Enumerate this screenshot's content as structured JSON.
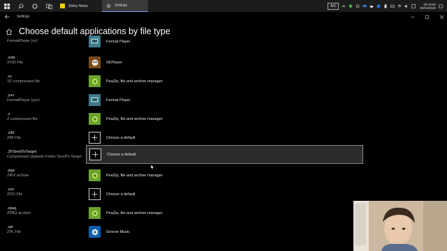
{
  "taskbar": {
    "apps": [
      {
        "label": "Sticky Notes",
        "icon": "sticky-notes-icon",
        "color": "#f5d000"
      },
      {
        "label": "Settings",
        "icon": "gear-icon",
        "color": "#cccccc",
        "active": true
      }
    ],
    "keyboard_indicator": "A/C",
    "clock_time": "09:18:50",
    "clock_date": "09/03/2020"
  },
  "window": {
    "title": "Settings"
  },
  "page": {
    "title": "Choose default applications by file type"
  },
  "rows": [
    {
      "ext": "",
      "desc": "FormatPlayer (xv)",
      "app": "Format Player",
      "icon": "format-player-icon"
    },
    {
      "ext": ".xvid",
      "desc": "XVID File",
      "app": "SKPlayer",
      "icon": "skplayer-icon"
    },
    {
      "ext": ".xz",
      "desc": "XZ compressed file",
      "app": "PeaZip, file and archive manager",
      "icon": "peazip-icon"
    },
    {
      "ext": ".yuv",
      "desc": "FormatPlayer (yuv)",
      "app": "Format Player",
      "icon": "format-player-icon"
    },
    {
      "ext": ".z",
      "desc": "Z compressed file",
      "app": "PeaZip, file and archive manager",
      "icon": "peazip-icon"
    },
    {
      "ext": ".z96",
      "desc": "Z96 File",
      "app": "Choose a default",
      "icon": "plus-icon"
    },
    {
      "ext": ".ZFSendToTarget",
      "desc": "Compressed (zipped) Folder SendTo Target",
      "app": "Choose a default",
      "icon": "plus-icon",
      "hover": true
    },
    {
      "ext": ".zipx",
      "desc": "ZIPX archive",
      "app": "PeaZip, file and archive manager",
      "icon": "peazip-icon"
    },
    {
      "ext": ".zoo",
      "desc": "ZOO File",
      "app": "Choose a default",
      "icon": "plus-icon"
    },
    {
      "ext": ".zpaq",
      "desc": "ZPAQ archive",
      "app": "PeaZip, file and archive manager",
      "icon": "peazip-icon"
    },
    {
      "ext": ".zpl",
      "desc": "ZPL File",
      "app": "Groove Music",
      "icon": "groove-music-icon"
    }
  ]
}
